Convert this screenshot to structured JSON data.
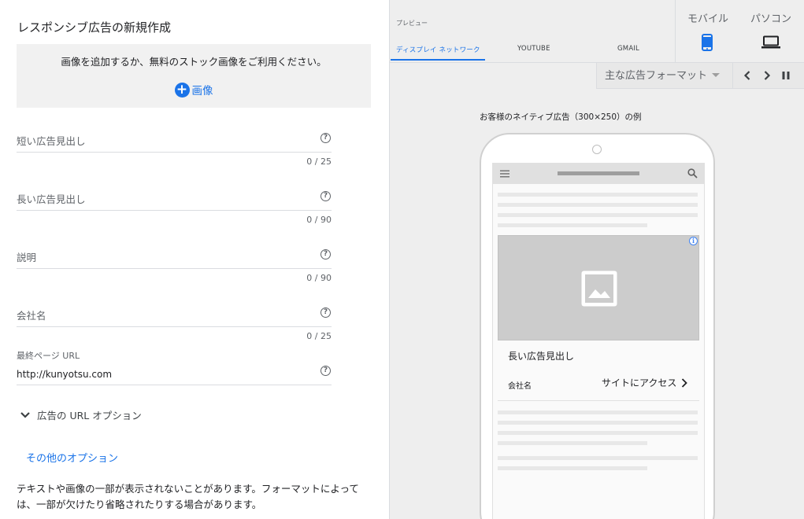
{
  "editor": {
    "title": "レスポンシブ広告の新規作成",
    "image_prompt": "画像を追加するか、無料のストック画像をご利用ください。",
    "add_image_label": "画像",
    "fields": [
      {
        "label": "短い広告見出し",
        "counter": "0 / 25"
      },
      {
        "label": "長い広告見出し",
        "counter": "0 / 90"
      },
      {
        "label": "説明",
        "counter": "0 / 90"
      },
      {
        "label": "会社名",
        "counter": "0 / 25"
      }
    ],
    "final_url": {
      "label": "最終ページ URL",
      "value": "http://kunyotsu.com"
    },
    "url_options_label": "広告の URL オプション",
    "other_options_label": "その他のオプション",
    "notice": "テキストや画像の一部が表示されないことがあります。フォーマットによっては、一部が欠けたり省略されたりする場合があります。"
  },
  "preview": {
    "label": "プレビュー",
    "tabs": [
      {
        "label": "ディスプレイ ネットワーク",
        "active": true
      },
      {
        "label": "YOUTUBE",
        "active": false
      },
      {
        "label": "GMAIL",
        "active": false
      }
    ],
    "devices": [
      {
        "label": "モバイル",
        "icon": "smartphone-icon",
        "active": true
      },
      {
        "label": "パソコン",
        "icon": "laptop-icon",
        "active": false
      }
    ],
    "format_select": "主な広告フォーマット",
    "example_caption": "お客様のネイティブ広告（300×250）の例",
    "ad": {
      "headline": "長い広告見出し",
      "company": "会社名",
      "cta": "サイトにアクセス"
    }
  },
  "colors": {
    "accent": "#1a73e8",
    "panel_bg": "#eeeeee",
    "image_placeholder": "#cccccc"
  }
}
